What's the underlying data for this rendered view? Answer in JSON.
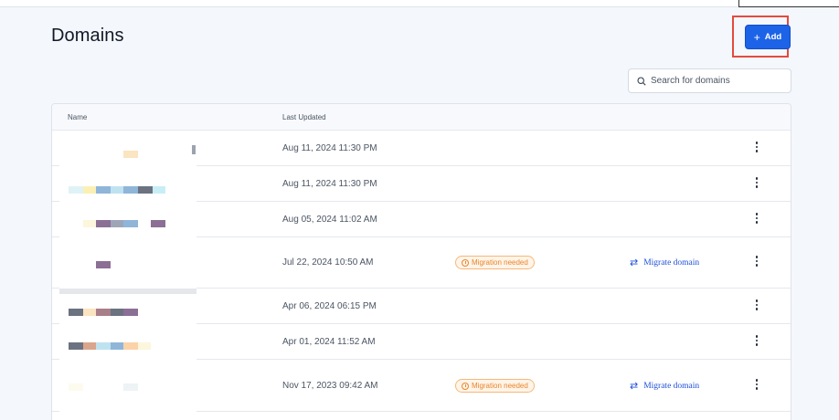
{
  "page": {
    "title": "Domains"
  },
  "toolbar": {
    "add_label": "Add",
    "add_icon": "plus-icon"
  },
  "search": {
    "placeholder": "Search for domains",
    "value": "",
    "icon": "search-icon"
  },
  "table": {
    "columns": {
      "name": "Name",
      "last_updated": "Last Updated"
    },
    "rows": [
      {
        "name": "",
        "last_updated": "Aug 11, 2024 11:30 PM",
        "status": "",
        "action": ""
      },
      {
        "name": "",
        "last_updated": "Aug 11, 2024 11:30 PM",
        "status": "",
        "action": ""
      },
      {
        "name": "",
        "last_updated": "Aug 05, 2024 11:02 AM",
        "status": "",
        "action": ""
      },
      {
        "name": "",
        "last_updated": "Jul 22, 2024 10:50 AM",
        "status": "Migration needed",
        "action": "Migrate domain"
      },
      {
        "name": "",
        "last_updated": "Apr 06, 2024 06:15 PM",
        "status": "",
        "action": ""
      },
      {
        "name": "",
        "last_updated": "Apr 01, 2024 11:52 AM",
        "status": "",
        "action": ""
      },
      {
        "name": "",
        "last_updated": "Nov 17, 2023 09:42 AM",
        "status": "Migration needed",
        "action": "Migrate domain"
      }
    ]
  },
  "colors": {
    "accent": "#1d63e8",
    "highlight": "#e34b3f",
    "warning": "#e8862d",
    "link": "#1d4fd8"
  }
}
